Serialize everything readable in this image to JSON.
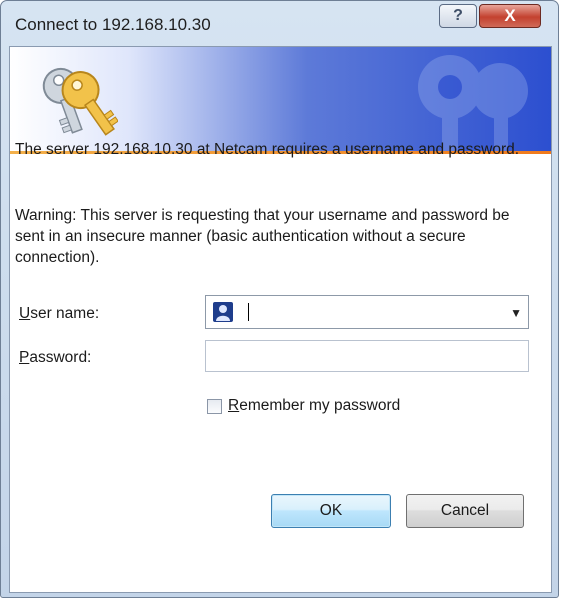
{
  "window": {
    "title": "Connect to 192.168.10.30",
    "help_glyph": "?",
    "close_glyph": "X"
  },
  "banner": {
    "icon": "keys-icon",
    "accent_colors": [
      "#2c4fd0",
      "#f07a1c"
    ]
  },
  "message": {
    "line1": "The server 192.168.10.30 at Netcam requires a username and password.",
    "warning": "Warning: This server is requesting that your username and password be sent in an insecure manner (basic authentication without a secure connection)."
  },
  "form": {
    "username_label_access": "U",
    "username_label_rest": "ser name:",
    "username_value": "",
    "username_icon": "user-icon",
    "password_label_access": "P",
    "password_label_rest": "assword:",
    "password_value": "",
    "remember_label_access": "R",
    "remember_label_rest": "emember my password",
    "remember_checked": false
  },
  "buttons": {
    "ok": "OK",
    "cancel": "Cancel"
  }
}
